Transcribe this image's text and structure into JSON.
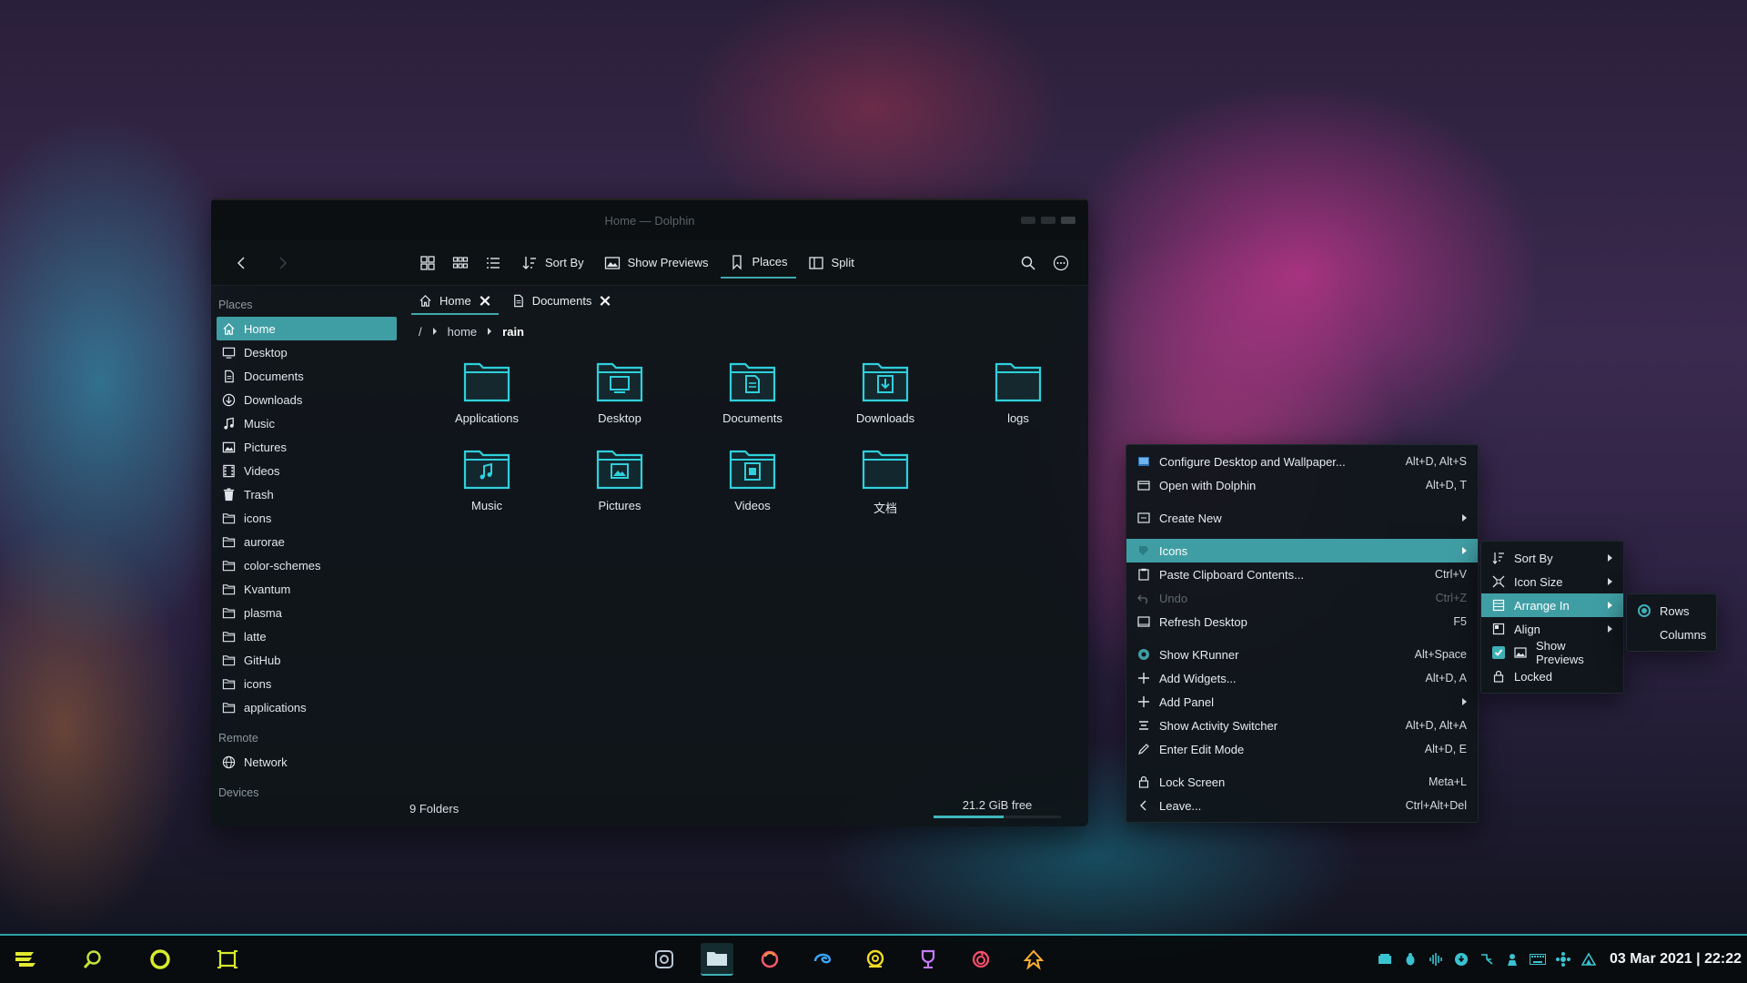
{
  "window": {
    "title": "Home — Dolphin"
  },
  "toolbar": {
    "sort_by": "Sort By",
    "show_previews": "Show Previews",
    "places": "Places",
    "split": "Split"
  },
  "sidebar": {
    "places_heading": "Places",
    "places": [
      {
        "label": "Home",
        "icon": "home-icon"
      },
      {
        "label": "Desktop",
        "icon": "desktop-icon"
      },
      {
        "label": "Documents",
        "icon": "documents-icon"
      },
      {
        "label": "Downloads",
        "icon": "downloads-icon"
      },
      {
        "label": "Music",
        "icon": "music-icon"
      },
      {
        "label": "Pictures",
        "icon": "pictures-icon"
      },
      {
        "label": "Videos",
        "icon": "videos-icon"
      },
      {
        "label": "Trash",
        "icon": "trash-icon"
      },
      {
        "label": "icons",
        "icon": "folder-icon"
      },
      {
        "label": "aurorae",
        "icon": "folder-icon"
      },
      {
        "label": "color-schemes",
        "icon": "folder-icon"
      },
      {
        "label": "Kvantum",
        "icon": "folder-icon"
      },
      {
        "label": "plasma",
        "icon": "folder-icon"
      },
      {
        "label": "latte",
        "icon": "folder-icon"
      },
      {
        "label": "GitHub",
        "icon": "folder-icon"
      },
      {
        "label": "icons",
        "icon": "folder-icon"
      },
      {
        "label": "applications",
        "icon": "folder-icon"
      }
    ],
    "remote_heading": "Remote",
    "remote": [
      {
        "label": "Network",
        "icon": "network-icon"
      }
    ],
    "devices_heading": "Devices"
  },
  "tabs": [
    {
      "label": "Home",
      "icon": "home-icon"
    },
    {
      "label": "Documents",
      "icon": "documents-icon"
    }
  ],
  "breadcrumb": {
    "root": "/",
    "parts": [
      "home",
      "rain"
    ]
  },
  "files": [
    {
      "name": "Applications",
      "glyph": "none"
    },
    {
      "name": "Desktop",
      "glyph": "desktop"
    },
    {
      "name": "Documents",
      "glyph": "doc"
    },
    {
      "name": "Downloads",
      "glyph": "down"
    },
    {
      "name": "logs",
      "glyph": "none"
    },
    {
      "name": "Music",
      "glyph": "music"
    },
    {
      "name": "Pictures",
      "glyph": "picture"
    },
    {
      "name": "Videos",
      "glyph": "video"
    },
    {
      "name": "文档",
      "glyph": "none"
    }
  ],
  "status": {
    "count": "9 Folders",
    "free": "21.2 GiB free",
    "used_fraction": 0.55
  },
  "desktop_menu": {
    "items": [
      {
        "label": "Configure Desktop and Wallpaper...",
        "shortcut": "Alt+D, Alt+S",
        "icon": "configure-icon"
      },
      {
        "label": "Open with Dolphin",
        "shortcut": "Alt+D, T",
        "icon": "dolphin-icon"
      },
      {
        "gap": true
      },
      {
        "label": "Create New",
        "submenu": true,
        "icon": "create-icon"
      },
      {
        "gap": true
      },
      {
        "label": "Icons",
        "submenu": true,
        "active": true,
        "icon": "icons-icon"
      },
      {
        "label": "Paste Clipboard Contents...",
        "shortcut": "Ctrl+V",
        "icon": "paste-icon"
      },
      {
        "label": "Undo",
        "shortcut": "Ctrl+Z",
        "disabled": true,
        "icon": "undo-icon"
      },
      {
        "label": "Refresh Desktop",
        "shortcut": "F5",
        "icon": "refresh-icon"
      },
      {
        "gap": true
      },
      {
        "label": "Show KRunner",
        "shortcut": "Alt+Space",
        "icon": "krunner-icon"
      },
      {
        "label": "Add Widgets...",
        "shortcut": "Alt+D, A",
        "icon": "plus-icon"
      },
      {
        "label": "Add Panel",
        "submenu": true,
        "icon": "plus-icon"
      },
      {
        "label": "Show Activity Switcher",
        "shortcut": "Alt+D, Alt+A",
        "icon": "activity-icon"
      },
      {
        "label": "Enter Edit Mode",
        "shortcut": "Alt+D, E",
        "icon": "edit-icon"
      },
      {
        "gap": true
      },
      {
        "label": "Lock Screen",
        "shortcut": "Meta+L",
        "icon": "lock-icon"
      },
      {
        "label": "Leave...",
        "shortcut": "Ctrl+Alt+Del",
        "icon": "leave-icon"
      }
    ]
  },
  "icons_menu": {
    "items": [
      {
        "label": "Sort By",
        "submenu": true,
        "icon": "sort-icon"
      },
      {
        "label": "Icon Size",
        "submenu": true,
        "icon": "icon-size-icon"
      },
      {
        "label": "Arrange In",
        "submenu": true,
        "active": true,
        "icon": "arrange-icon"
      },
      {
        "label": "Align",
        "submenu": true,
        "icon": "align-icon"
      },
      {
        "label": "Show Previews",
        "checked": true,
        "icon": "preview-icon"
      },
      {
        "label": "Locked",
        "icon": "lock-icon"
      }
    ]
  },
  "arrange_menu": {
    "items": [
      {
        "label": "Rows",
        "selected": true
      },
      {
        "label": "Columns",
        "selected": false
      }
    ]
  },
  "taskbar": {
    "clock": "03 Mar 2021 | 22:22",
    "accent": "#3fb0b6",
    "launchers": [
      "menu-icon",
      "search-icon",
      "circle-icon",
      "activity-icon"
    ],
    "tasks": [
      "screenshot-icon",
      "dolphin-icon",
      "firefox-icon",
      "edge-icon",
      "chat-icon",
      "trophy-icon",
      "spiral-icon",
      "kup-icon"
    ],
    "tray": [
      "drive-icon",
      "bug-icon",
      "audio-icon",
      "update-icon",
      "network-tray-icon",
      "user-icon",
      "keyboard-icon",
      "settings-tray-icon",
      "wifi-icon"
    ]
  },
  "colors": {
    "accent": "#3f9ea4",
    "window_bg": "#0e1418"
  }
}
